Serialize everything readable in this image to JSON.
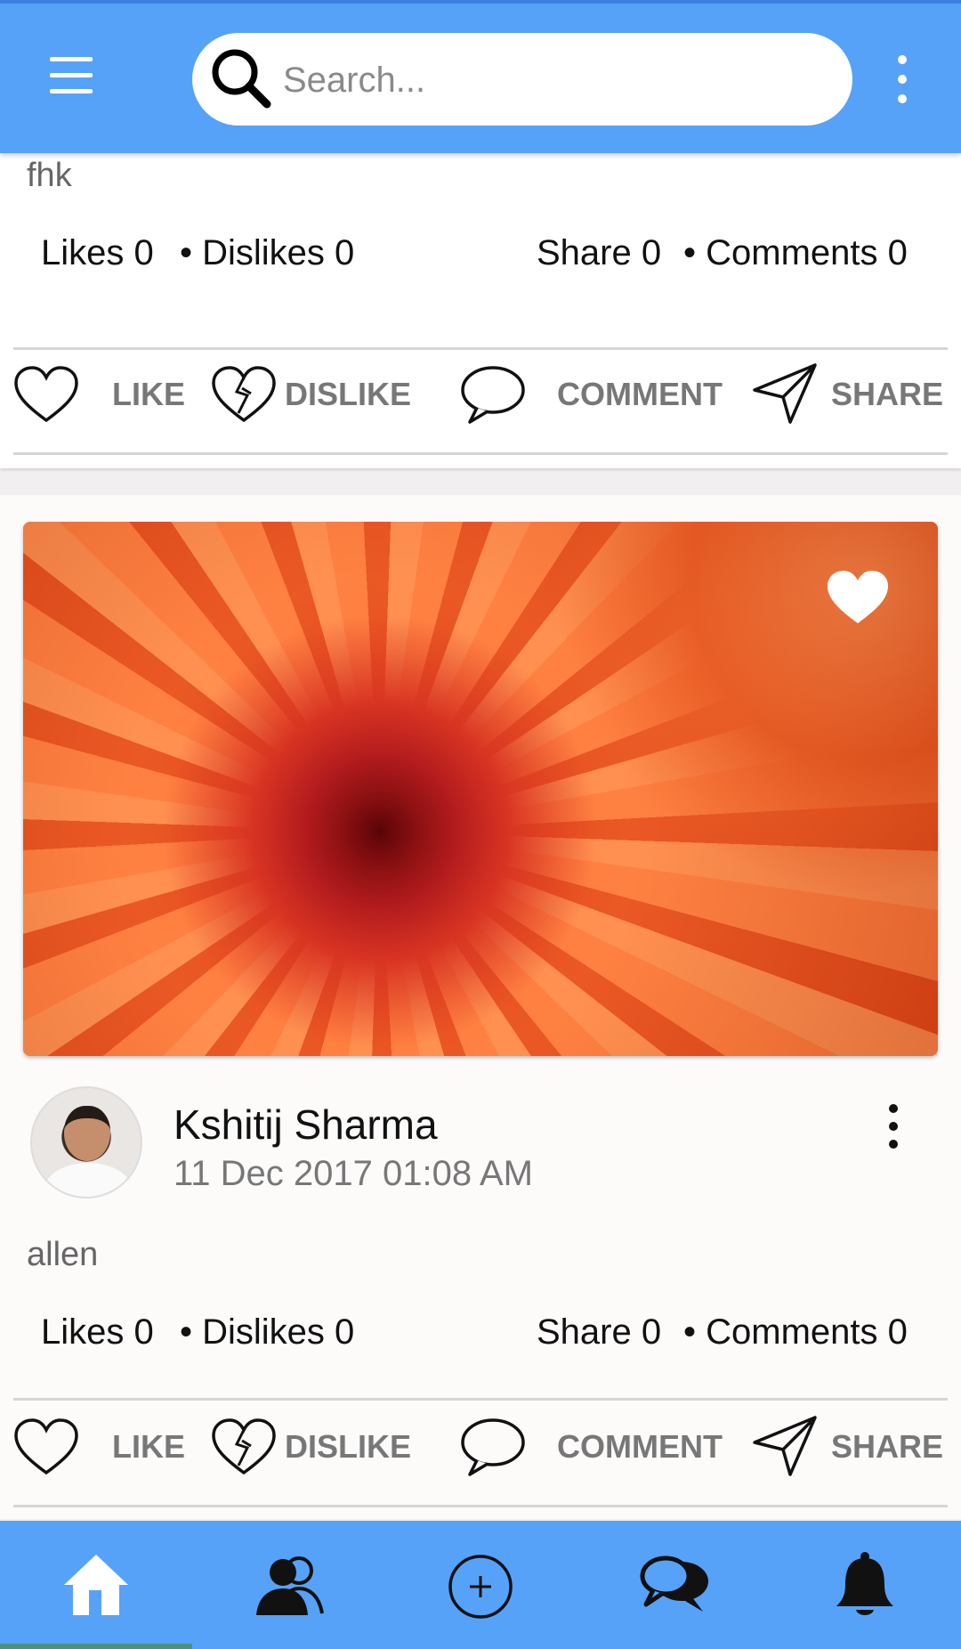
{
  "topbar": {
    "search_placeholder": "Search..."
  },
  "posts": [
    {
      "text": "fhk",
      "stats": {
        "likes": "Likes 0",
        "dislikes": "• Dislikes 0",
        "share": "Share 0",
        "comments": "• Comments 0"
      },
      "actions": {
        "like": "LIKE",
        "dislike": "DISLIKE",
        "comment": "COMMENT",
        "share": "SHARE"
      }
    },
    {
      "author": "Kshitij Sharma",
      "timestamp": "11 Dec 2017 01:08 AM",
      "text": "allen",
      "stats": {
        "likes": "Likes 0",
        "dislikes": "• Dislikes 0",
        "share": "Share 0",
        "comments": "• Comments 0"
      },
      "actions": {
        "like": "LIKE",
        "dislike": "DISLIKE",
        "comment": "COMMENT",
        "share": "SHARE"
      }
    }
  ],
  "bottom_nav": {
    "items": [
      "home-icon",
      "friends-icon",
      "add-post-icon",
      "messages-icon",
      "notifications-icon"
    ],
    "active": "home-icon"
  },
  "colors": {
    "primary": "#56a2f8",
    "action_label": "#777777",
    "indicator": "#4f8f7e"
  }
}
